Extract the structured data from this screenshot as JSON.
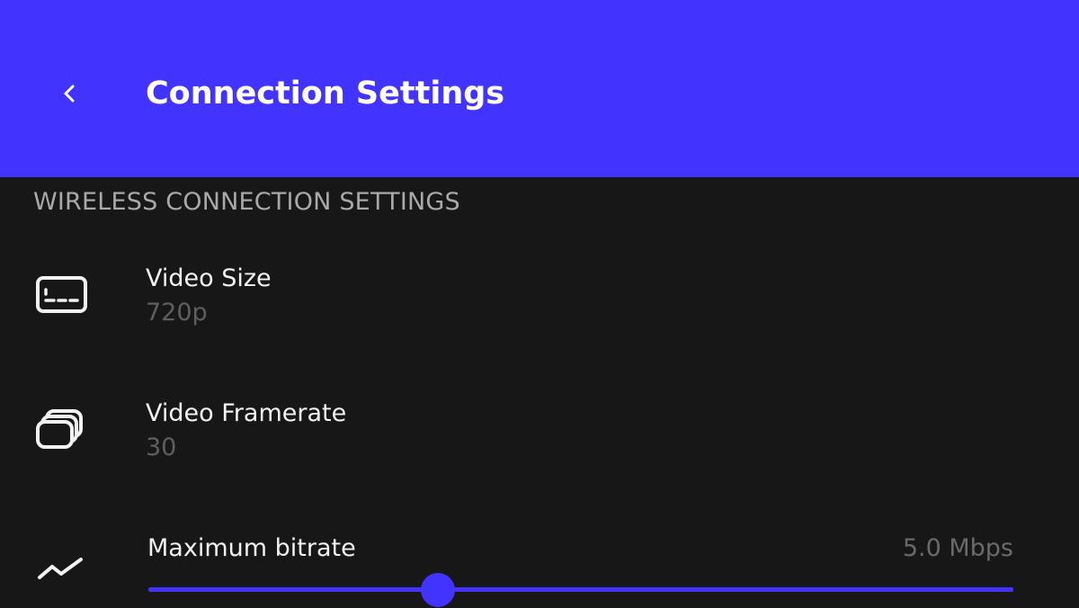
{
  "header": {
    "title": "Connection Settings",
    "back_icon": "chevron-left-icon",
    "background": "#4333ff"
  },
  "section": {
    "title": "WIRELESS CONNECTION SETTINGS"
  },
  "settings": [
    {
      "title": "Video Size",
      "value": "720p",
      "icon": "video-size-icon"
    },
    {
      "title": "Video Framerate",
      "value": "30",
      "icon": "framerate-icon"
    }
  ],
  "bitrate": {
    "title": "Maximum bitrate",
    "value_label": "5.0 Mbps",
    "icon": "bitrate-trend-icon",
    "slider_fraction": 0.335,
    "accent": "#4333ff"
  }
}
